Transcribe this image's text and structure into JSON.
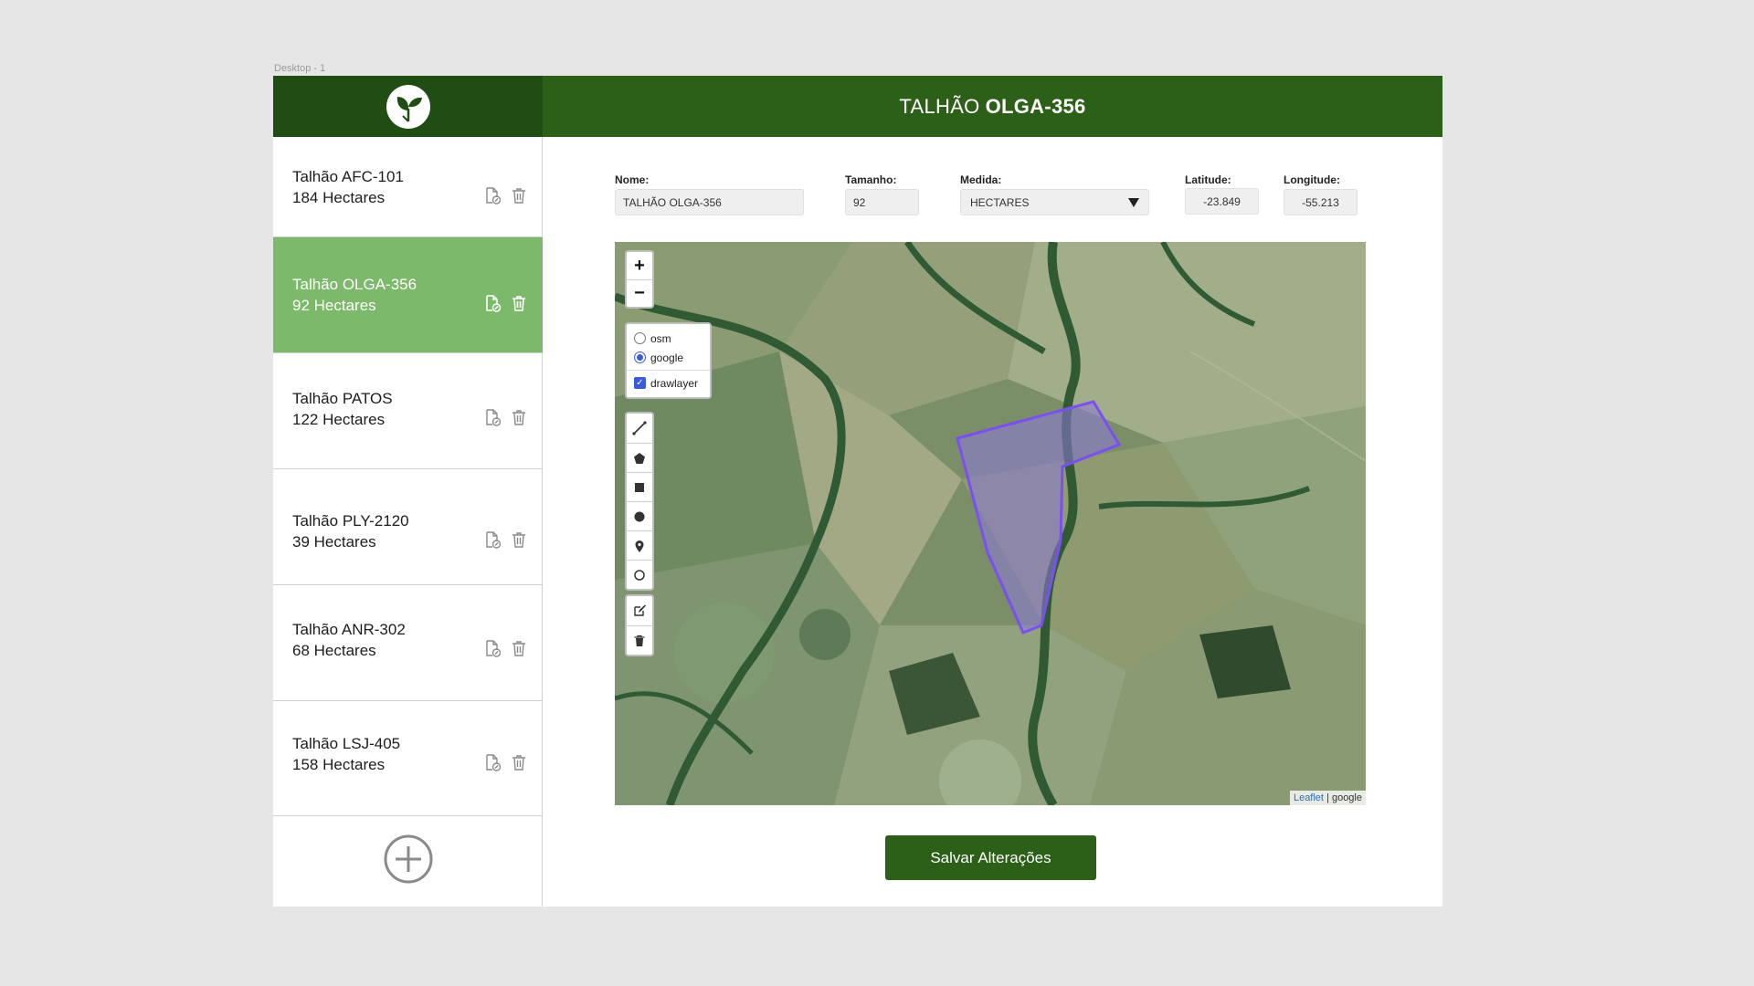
{
  "frame_label": "Desktop - 1",
  "header": {
    "prefix": "TALHÃO",
    "name": "OLGA-356"
  },
  "sidebar": {
    "items": [
      {
        "name": "Talhão AFC-101",
        "size": "184 Hectares",
        "active": false
      },
      {
        "name": "Talhão OLGA-356",
        "size": "92 Hectares",
        "active": true
      },
      {
        "name": "Talhão PATOS",
        "size": "122 Hectares",
        "active": false
      },
      {
        "name": "Talhão PLY-2120",
        "size": "39 Hectares",
        "active": false
      },
      {
        "name": "Talhão ANR-302",
        "size": "68 Hectares",
        "active": false
      },
      {
        "name": "Talhão LSJ-405",
        "size": "158 Hectares",
        "active": false
      }
    ]
  },
  "form": {
    "nome_label": "Nome:",
    "nome_value": "TALHÃO OLGA-356",
    "tamanho_label": "Tamanho:",
    "tamanho_value": "92",
    "medida_label": "Medida:",
    "medida_value": "HECTARES",
    "latitude_label": "Latitude:",
    "latitude_value": "-23.849",
    "longitude_label": "Longitude:",
    "longitude_value": "-55.213"
  },
  "map": {
    "layers": {
      "osm": "osm",
      "google": "google",
      "drawlayer": "drawlayer",
      "selected": "google"
    },
    "attribution_link": "Leaflet",
    "attribution_text": " | google",
    "polygon_color": "#7b4ff0"
  },
  "save_label": "Salvar Alterações",
  "colors": {
    "dark_green": "#1f4d14",
    "header_green": "#2c5f17",
    "active_green": "#7db96a"
  }
}
